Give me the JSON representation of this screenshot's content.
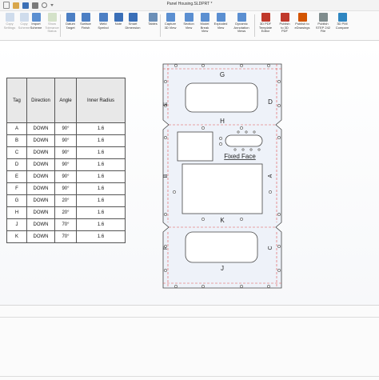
{
  "window": {
    "title": "Panel Housing.SLDPRT *"
  },
  "ribbon": {
    "buttons": [
      {
        "id": "copy-settings",
        "label": "Copy\nSettings",
        "enabled": false,
        "icon": "copy-icon",
        "color": "#8fb0d8"
      },
      {
        "id": "copy-scheme",
        "label": "Copy\nScheme",
        "enabled": false,
        "icon": "scheme-icon",
        "color": "#8fb0d8"
      },
      {
        "id": "import-scheme",
        "label": "Import\nScheme",
        "enabled": true,
        "icon": "import-icon",
        "color": "#5b8fd1"
      },
      {
        "id": "show-tolerance-status",
        "label": "Show\nTolerance\nStatus",
        "enabled": false,
        "icon": "tolerance-icon",
        "color": "#9bbf80"
      },
      {
        "id": "datum-target",
        "label": "Datum\nTarget",
        "enabled": true,
        "icon": "datum-icon",
        "color": "#4c7fc4"
      },
      {
        "id": "surface-finish",
        "label": "Surface\nFinish",
        "enabled": true,
        "icon": "surface-finish-icon",
        "color": "#4c7fc4"
      },
      {
        "id": "weld-symbol",
        "label": "Weld\nSymbol",
        "enabled": true,
        "icon": "weld-icon",
        "color": "#4c7fc4"
      },
      {
        "id": "note",
        "label": "Note",
        "enabled": true,
        "icon": "note-icon",
        "color": "#3a6fb8"
      },
      {
        "id": "smart-dimension",
        "label": "Smart\nDimension",
        "enabled": true,
        "icon": "smart-dimension-icon",
        "color": "#3a6fb8"
      },
      {
        "id": "tables",
        "label": "Tables",
        "enabled": true,
        "icon": "table-icon",
        "color": "#6b8fb8"
      },
      {
        "id": "capture-3d-view",
        "label": "Capture\n3D View",
        "enabled": true,
        "icon": "camera-icon",
        "color": "#5b8fd1"
      },
      {
        "id": "section-view",
        "label": "Section\nView",
        "enabled": true,
        "icon": "section-icon",
        "color": "#5b8fd1"
      },
      {
        "id": "model-break-view",
        "label": "Model\nBreak\nView",
        "enabled": true,
        "icon": "break-icon",
        "color": "#5b8fd1"
      },
      {
        "id": "exploded-view",
        "label": "Exploded\nView",
        "enabled": true,
        "icon": "exploded-icon",
        "color": "#5b8fd1"
      },
      {
        "id": "dynamic-annotation-views",
        "label": "Dynamic\nAnnotation\nViews",
        "enabled": true,
        "icon": "annotation-views-icon",
        "color": "#5b8fd1"
      },
      {
        "id": "3d-pdf-template-editor",
        "label": "3D PDF\nTemplate\nEditor",
        "enabled": true,
        "icon": "pdf-template-icon",
        "color": "#c0392b"
      },
      {
        "id": "publish-to-3d-pdf",
        "label": "Publish\nto 3D\nPDF",
        "enabled": true,
        "icon": "pdf-icon",
        "color": "#c0392b"
      },
      {
        "id": "publish-to-edrawings",
        "label": "Publish to\neDrawings",
        "enabled": true,
        "icon": "edrawings-icon",
        "color": "#d35400"
      },
      {
        "id": "publish-step-242-file",
        "label": "Publish\nSTEP 242\nFile",
        "enabled": true,
        "icon": "step-icon",
        "color": "#7f8c8d"
      },
      {
        "id": "3d-pmi-compare",
        "label": "3D PMI\nCompare",
        "enabled": true,
        "icon": "compare-icon",
        "color": "#2e86c1"
      }
    ]
  },
  "bend_table": {
    "headers": [
      "Tag",
      "Direction",
      "Angle",
      "Inner Radius"
    ],
    "rows": [
      [
        "A",
        "DOWN",
        "90°",
        "1.6"
      ],
      [
        "B",
        "DOWN",
        "90°",
        "1.6"
      ],
      [
        "C",
        "DOWN",
        "90°",
        "1.6"
      ],
      [
        "D",
        "DOWN",
        "90°",
        "1.6"
      ],
      [
        "E",
        "DOWN",
        "90°",
        "1.6"
      ],
      [
        "F",
        "DOWN",
        "90°",
        "1.6"
      ],
      [
        "G",
        "DOWN",
        "20°",
        "1.6"
      ],
      [
        "H",
        "DOWN",
        "20°",
        "1.6"
      ],
      [
        "J",
        "DOWN",
        "70°",
        "1.6"
      ],
      [
        "K",
        "DOWN",
        "70°",
        "1.6"
      ]
    ]
  },
  "drawing": {
    "face_label": "Fixed Face",
    "bend_labels": {
      "G": "G",
      "E": "E",
      "D": "D",
      "H": "H",
      "B": "B",
      "A": "A",
      "K": "K",
      "F": "F",
      "C": "C",
      "J": "J"
    },
    "colors": {
      "outline": "#444444",
      "bendline": "#e05050",
      "panel_fill": "#eef2f9"
    }
  }
}
